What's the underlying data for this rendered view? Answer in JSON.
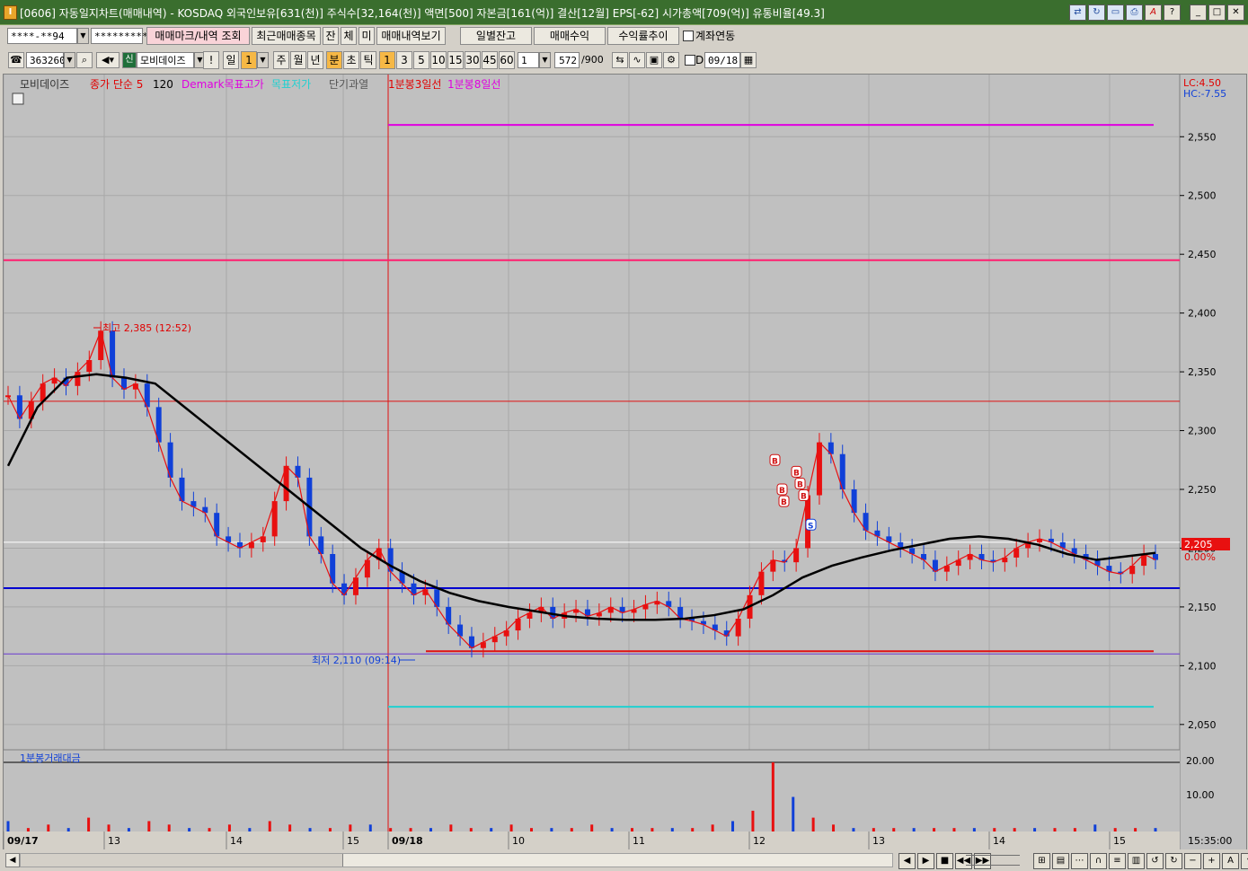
{
  "window": {
    "code": "[0606]",
    "title": "자동일지차트(매매내역) - KOSDAQ 외국인보유[631(천)] 주식수[32,164(천)] 액면[500] 자본금[161(억)] 결산[12월] EPS[-62] 시가총액[709(억)] 유통비율[49.3]"
  },
  "toolbar1": {
    "account_masked": "****-**94",
    "password_masked": "*********",
    "trade_mark_button": "매매마크/내역 조회",
    "recent_stocks_button": "최근매매종목",
    "btn_jan": "잔",
    "btn_che": "체",
    "btn_mi": "미",
    "trade_history_button": "매매내역보기",
    "daily_balance_button": "일별잔고",
    "trade_profit_button": "매매수익",
    "return_trend_button": "수익률추이",
    "account_link_label": "계좌연동"
  },
  "toolbar2": {
    "stock_code": "363260",
    "new_badge": "신",
    "stock_name": "모비데이즈",
    "exclaim": "!",
    "period_day": "일",
    "period_value": "1",
    "period_week": "주",
    "period_month": "월",
    "period_year": "년",
    "period_min": "분",
    "period_sec": "초",
    "period_tick": "틱",
    "intervals": [
      "1",
      "3",
      "5",
      "10",
      "15",
      "30",
      "45",
      "60"
    ],
    "interval_custom": "1",
    "count": "572",
    "count_max": "/900",
    "date_checkbox_label": "D",
    "date_value": "09/18"
  },
  "legend": {
    "stock": "모비데이즈",
    "ma_label": "종가 단순 5",
    "ma_value": "120",
    "demark_high": "Demark목표고가",
    "demark_low": "목표저가",
    "overheat": "단기과열",
    "day3": "1분봉3일선",
    "day8": "1분봉8일선",
    "lc": "LC:4.50",
    "hc": "HC:-7.55"
  },
  "annotations": {
    "high_label": "최고 2,385 (12:52)",
    "low_label": "최저 2,110 (09:14)",
    "current_price": "2,205",
    "current_change": "0.00%"
  },
  "volume_panel": {
    "title": "1분봉거래대금",
    "ticks": [
      "20.00",
      "10.00"
    ]
  },
  "x_axis": {
    "labels": [
      "09/17",
      "13",
      "14",
      "15",
      "09/18",
      "10",
      "11",
      "12",
      "13",
      "14",
      "15"
    ],
    "time": "15:35:00"
  },
  "colors": {
    "up": "#e81010",
    "down": "#1040d8",
    "ma": "#000000",
    "target_high": "#e000e0",
    "level_pink": "#ff1e6e",
    "level_blue": "#0000d0",
    "target_low": "#20d0d0"
  },
  "chart_data": {
    "type": "candlestick",
    "y_axis_ticks": [
      2550,
      2500,
      2450,
      2400,
      2350,
      2300,
      2250,
      2200,
      2150,
      2100,
      2050
    ],
    "ylim": [
      2030,
      2580
    ],
    "x_sessions": [
      "09/17",
      "09/18"
    ],
    "reference_levels": {
      "demark_target_high": 2560,
      "resistance": 2445,
      "prev_high_line": 2325,
      "current": 2205,
      "support": 2166,
      "low_line": 2110,
      "demark_target_low": 2065
    },
    "close_series": [
      2330,
      2310,
      2325,
      2340,
      2345,
      2338,
      2350,
      2360,
      2385,
      2345,
      2335,
      2340,
      2320,
      2290,
      2260,
      2240,
      2235,
      2230,
      2210,
      2205,
      2200,
      2205,
      2210,
      2240,
      2270,
      2260,
      2210,
      2195,
      2170,
      2160,
      2175,
      2190,
      2200,
      2180,
      2170,
      2160,
      2165,
      2150,
      2135,
      2125,
      2115,
      2120,
      2125,
      2130,
      2140,
      2145,
      2150,
      2140,
      2145,
      2148,
      2142,
      2145,
      2150,
      2145,
      2148,
      2152,
      2155,
      2150,
      2140,
      2138,
      2135,
      2130,
      2125,
      2140,
      2160,
      2180,
      2190,
      2188,
      2200,
      2245,
      2290,
      2280,
      2250,
      2230,
      2215,
      2210,
      2205,
      2200,
      2195,
      2190,
      2180,
      2185,
      2190,
      2195,
      2190,
      2188,
      2192,
      2200,
      2205,
      2208,
      2205,
      2200,
      2195,
      2190,
      2185,
      2180,
      2178,
      2185,
      2195,
      2190
    ],
    "ma_series": [
      2270,
      2320,
      2345,
      2348,
      2345,
      2340,
      2320,
      2300,
      2280,
      2260,
      2240,
      2220,
      2200,
      2185,
      2172,
      2162,
      2155,
      2150,
      2146,
      2142,
      2140,
      2139,
      2139,
      2140,
      2143,
      2148,
      2160,
      2175,
      2185,
      2192,
      2198,
      2203,
      2208,
      2210,
      2208,
      2203,
      2195,
      2190,
      2193,
      2196
    ],
    "volume_series": [
      3,
      1,
      2,
      1,
      4,
      2,
      1,
      3,
      2,
      1,
      1,
      2,
      1,
      3,
      2,
      1,
      1,
      2,
      2,
      1,
      1,
      1,
      2,
      1,
      1,
      2,
      1,
      1,
      1,
      2,
      1,
      1,
      1,
      1,
      1,
      2,
      3,
      6,
      20,
      10,
      4,
      2,
      1,
      1,
      1,
      1,
      1,
      1,
      1,
      1,
      1,
      1,
      1,
      1,
      2,
      1,
      1,
      1
    ]
  }
}
